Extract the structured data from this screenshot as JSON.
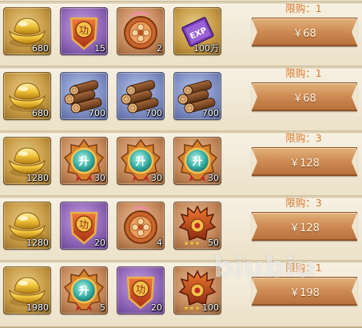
{
  "rows": [
    {
      "limit": "限购：1",
      "price": "￥68",
      "items": [
        {
          "icon": "gold-ingot-icon",
          "bg": "gold",
          "qty": "680"
        },
        {
          "icon": "red-token-icon",
          "bg": "purple",
          "qty": "15"
        },
        {
          "icon": "flower-medallion-icon",
          "bg": "orange",
          "qty": "2"
        },
        {
          "icon": "exp-scroll-icon",
          "bg": "gold",
          "qty": "100万"
        }
      ]
    },
    {
      "limit": "限购：1",
      "price": "￥68",
      "items": [
        {
          "icon": "gold-ingot-icon",
          "bg": "gold",
          "qty": "680"
        },
        {
          "icon": "wood-logs-icon",
          "bg": "blue",
          "qty": "700"
        },
        {
          "icon": "wood-logs-icon",
          "bg": "blue",
          "qty": "700"
        },
        {
          "icon": "wood-logs-icon",
          "bg": "blue",
          "qty": "700"
        }
      ]
    },
    {
      "limit": "限购：3",
      "price": "￥128",
      "items": [
        {
          "icon": "gold-ingot-icon",
          "bg": "gold",
          "qty": "1280"
        },
        {
          "icon": "jade-medal-icon",
          "bg": "orange",
          "qty": "30"
        },
        {
          "icon": "jade-medal-icon",
          "bg": "orange",
          "qty": "30"
        },
        {
          "icon": "jade-medal-icon",
          "bg": "orange",
          "qty": "30"
        }
      ]
    },
    {
      "limit": "限购：3",
      "price": "￥128",
      "items": [
        {
          "icon": "gold-ingot-icon",
          "bg": "gold",
          "qty": "1280"
        },
        {
          "icon": "red-token-icon",
          "bg": "purple",
          "qty": "20"
        },
        {
          "icon": "flower-medallion-icon",
          "bg": "orange",
          "qty": "4"
        },
        {
          "icon": "helmet-crest-icon",
          "bg": "orange",
          "qty": "50",
          "stars": "★★★"
        }
      ]
    },
    {
      "limit": "限购：1",
      "price": "￥198",
      "items": [
        {
          "icon": "gold-ingot-icon",
          "bg": "gold",
          "qty": "1980"
        },
        {
          "icon": "jade-medal-icon",
          "bg": "orange",
          "qty": "5"
        },
        {
          "icon": "red-token-icon",
          "bg": "purple",
          "qty": "20"
        },
        {
          "icon": "helmet-crest-icon",
          "bg": "orange",
          "qty": "100",
          "stars": "★★★"
        }
      ]
    }
  ],
  "watermark": "biubiu",
  "exp_label": "EXP",
  "seal_char": "功",
  "jade_char": "升",
  "colors": {
    "limit_text": "#d9772c",
    "button": "#cf8d55",
    "gold_slot": "#c79a45",
    "purple_slot": "#9066b8",
    "blue_slot": "#7f8fc4",
    "orange_slot": "#c68a5c"
  }
}
